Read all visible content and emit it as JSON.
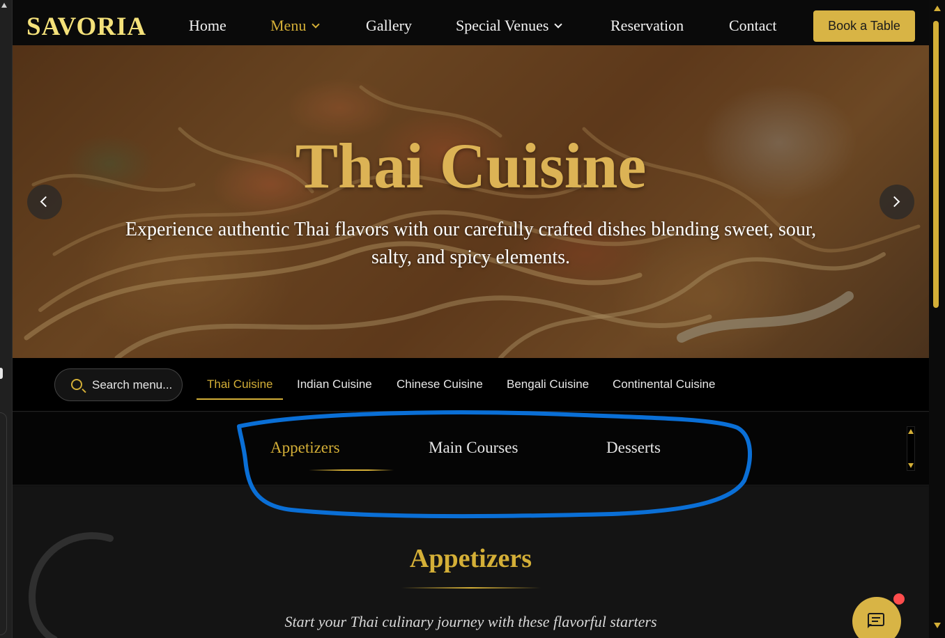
{
  "header": {
    "logo": "SAVORIA",
    "nav": [
      {
        "label": "Home",
        "dropdown": false
      },
      {
        "label": "Menu",
        "dropdown": true,
        "active": true
      },
      {
        "label": "Gallery",
        "dropdown": false
      },
      {
        "label": "Special Venues",
        "dropdown": true
      },
      {
        "label": "Reservation",
        "dropdown": false
      },
      {
        "label": "Contact",
        "dropdown": false
      }
    ],
    "cta": "Book a Table"
  },
  "hero": {
    "title": "Thai Cuisine",
    "subtitle": "Experience authentic Thai flavors with our carefully crafted dishes blending sweet, sour, salty, and spicy elements.",
    "prev_icon": "chevron-left-icon",
    "next_icon": "chevron-right-icon"
  },
  "cuisine_bar": {
    "search_placeholder": "Search menu...",
    "tabs": [
      {
        "label": "Thai Cuisine",
        "active": true
      },
      {
        "label": "Indian Cuisine"
      },
      {
        "label": "Chinese Cuisine"
      },
      {
        "label": "Bengali Cuisine"
      },
      {
        "label": "Continental Cuisine"
      }
    ]
  },
  "course_tabs": [
    {
      "label": "Appetizers",
      "active": true
    },
    {
      "label": "Main Courses"
    },
    {
      "label": "Desserts"
    }
  ],
  "section": {
    "title": "Appetizers",
    "subtitle": "Start your Thai culinary journey with these flavorful starters"
  },
  "colors": {
    "accent_gold": "#d4af37",
    "logo": "#f4e17a",
    "button": "#d8b445",
    "annotation_blue": "#0a6fd6",
    "notification_dot": "#ff4d4d"
  },
  "icons": [
    "search-icon",
    "chat-icon",
    "chevron-down-icon",
    "chevron-left-icon",
    "chevron-right-icon"
  ]
}
